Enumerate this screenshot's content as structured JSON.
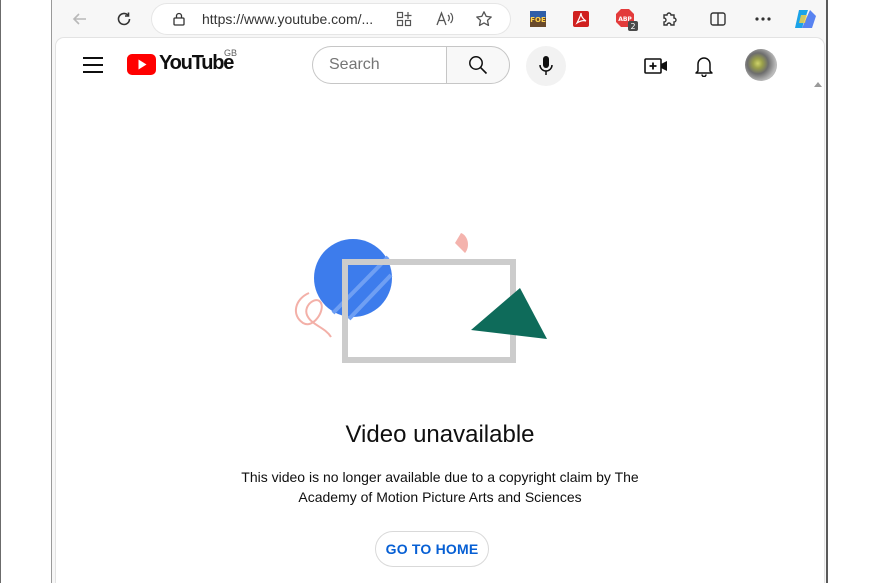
{
  "browser": {
    "address_url": "https://www.youtube.com/...",
    "extension_badge_count": "2"
  },
  "youtube": {
    "logo_text": "YouTube",
    "region": "GB",
    "search_placeholder": "Search",
    "accent_color": "#ff0000"
  },
  "error": {
    "title": "Video unavailable",
    "message_line1": "This video is no longer available due to a copyright claim by The",
    "message_line2": "Academy of Motion Picture Arts and Sciences",
    "button_label": "GO TO HOME"
  }
}
